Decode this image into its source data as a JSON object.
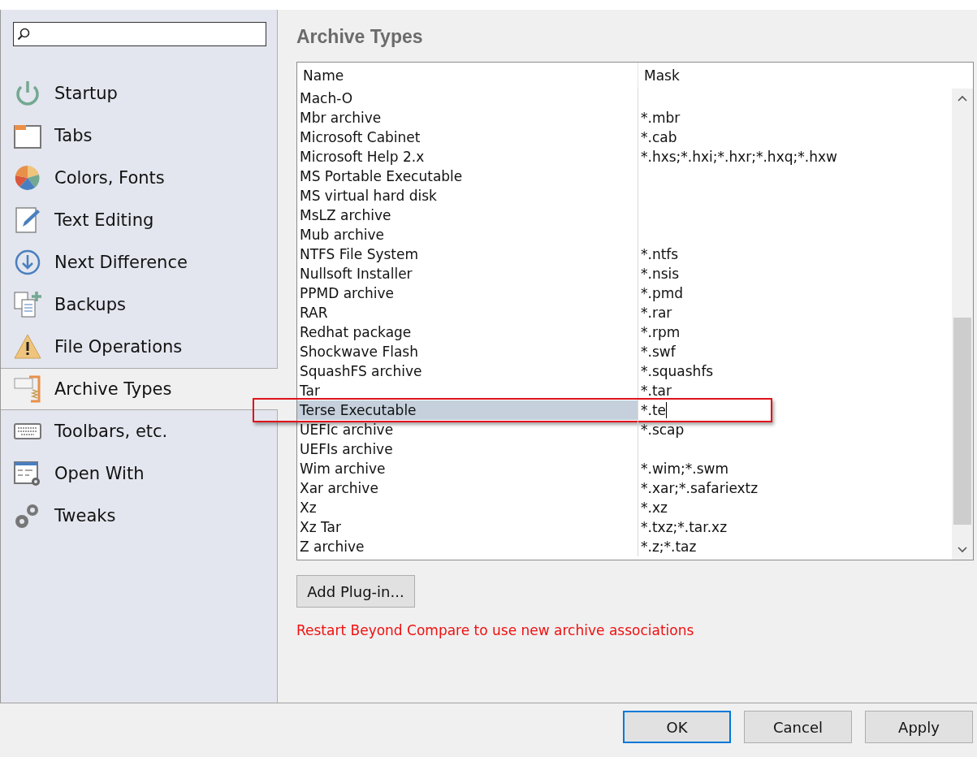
{
  "sidebar": {
    "items": [
      {
        "label": "Startup",
        "selected": false
      },
      {
        "label": "Tabs",
        "selected": false
      },
      {
        "label": "Colors, Fonts",
        "selected": false
      },
      {
        "label": "Text Editing",
        "selected": false
      },
      {
        "label": "Next Difference",
        "selected": false
      },
      {
        "label": "Backups",
        "selected": false
      },
      {
        "label": "File Operations",
        "selected": false
      },
      {
        "label": "Archive Types",
        "selected": true
      },
      {
        "label": "Toolbars, etc.",
        "selected": false
      },
      {
        "label": "Open With",
        "selected": false
      },
      {
        "label": "Tweaks",
        "selected": false
      }
    ]
  },
  "page": {
    "title": "Archive Types",
    "table": {
      "columns": [
        "Name",
        "Mask"
      ],
      "rows": [
        {
          "name": "Mach-O",
          "mask": "",
          "selected": false
        },
        {
          "name": "Mbr archive",
          "mask": "*.mbr",
          "selected": false
        },
        {
          "name": "Microsoft Cabinet",
          "mask": "*.cab",
          "selected": false
        },
        {
          "name": "Microsoft Help 2.x",
          "mask": "*.hxs;*.hxi;*.hxr;*.hxq;*.hxw",
          "selected": false
        },
        {
          "name": "MS Portable Executable",
          "mask": "",
          "selected": false
        },
        {
          "name": "MS virtual hard disk",
          "mask": "",
          "selected": false
        },
        {
          "name": "MsLZ archive",
          "mask": "",
          "selected": false
        },
        {
          "name": "Mub archive",
          "mask": "",
          "selected": false
        },
        {
          "name": "NTFS File System",
          "mask": "*.ntfs",
          "selected": false
        },
        {
          "name": "Nullsoft Installer",
          "mask": "*.nsis",
          "selected": false
        },
        {
          "name": "PPMD archive",
          "mask": "*.pmd",
          "selected": false
        },
        {
          "name": "RAR",
          "mask": "*.rar",
          "selected": false
        },
        {
          "name": "Redhat package",
          "mask": "*.rpm",
          "selected": false
        },
        {
          "name": "Shockwave Flash",
          "mask": "*.swf",
          "selected": false
        },
        {
          "name": "SquashFS archive",
          "mask": "*.squashfs",
          "selected": false
        },
        {
          "name": "Tar",
          "mask": "*.tar",
          "selected": false
        },
        {
          "name": "Terse Executable",
          "mask": "*.te",
          "selected": true
        },
        {
          "name": "UEFIc archive",
          "mask": "*.scap",
          "selected": false
        },
        {
          "name": "UEFIs archive",
          "mask": "",
          "selected": false
        },
        {
          "name": "Wim archive",
          "mask": "*.wim;*.swm",
          "selected": false
        },
        {
          "name": "Xar archive",
          "mask": "*.xar;*.safariextz",
          "selected": false
        },
        {
          "name": "Xz",
          "mask": "*.xz",
          "selected": false
        },
        {
          "name": "Xz Tar",
          "mask": "*.txz;*.tar.xz",
          "selected": false
        },
        {
          "name": "Z archive",
          "mask": "*.z;*.taz",
          "selected": false
        }
      ]
    },
    "add_button": "Add Plug-in...",
    "notice": "Restart Beyond Compare to use new archive associations"
  },
  "buttons": [
    {
      "label": "OK",
      "selected": true
    },
    {
      "label": "Cancel",
      "selected": false
    },
    {
      "label": "Apply",
      "selected": false
    }
  ]
}
